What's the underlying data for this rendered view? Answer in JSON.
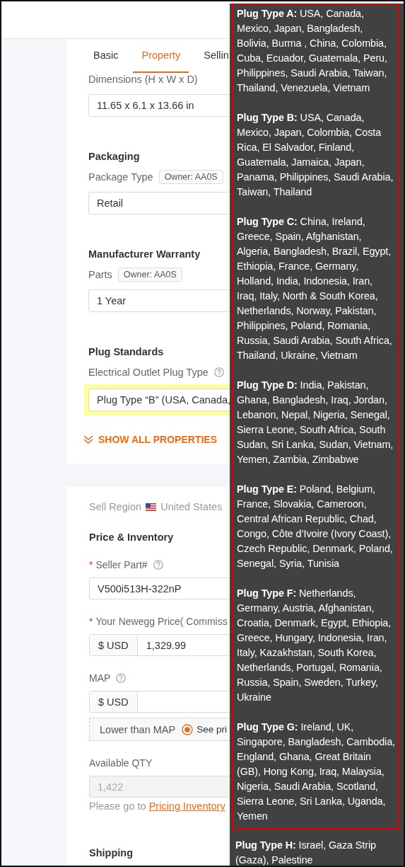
{
  "tabs": [
    {
      "label": "Basic",
      "selected": false
    },
    {
      "label": "Property",
      "selected": true
    },
    {
      "label": "Sellin",
      "selected": false
    }
  ],
  "property_card": {
    "fields": [
      {
        "label": "Dimensions (H x W x D)",
        "value": "11.65 x 6.1 x 13.66 in"
      },
      {
        "heading": "Packaging",
        "label": "Package Type",
        "owner": "Owner: AA0S",
        "value": "Retail"
      },
      {
        "heading": "Manufacturer Warranty",
        "label": "Parts",
        "owner": "Owner: AA0S",
        "value": "1 Year"
      },
      {
        "heading": "Plug Standards",
        "label": "Electrical Outlet Plug Type",
        "help": true,
        "highlighted": true,
        "value": "Plug Type “B” (USA, Canada,"
      }
    ],
    "show_all": "SHOW ALL PROPERTIES"
  },
  "selling_card": {
    "sell_region": {
      "label": "Sell Region",
      "country": "United States"
    },
    "heading": "Price & Inventory",
    "fields": [
      {
        "kind": "text",
        "marker": "*",
        "label": "Seller Part#",
        "help": true,
        "value": "V500i513H-322nP"
      },
      {
        "kind": "currency",
        "marker": "*",
        "label": "Your Newegg Price( Commiss",
        "prefix": "$ USD",
        "value": "1,329.99"
      },
      {
        "kind": "currency",
        "label": "MAP",
        "help": true,
        "prefix": "$ USD"
      },
      {
        "kind": "option",
        "label": "Lower than MAP",
        "options": [
          {
            "label": "See pri",
            "selected": true
          }
        ]
      },
      {
        "kind": "text",
        "label": "Available QTY",
        "disabled": true,
        "value": "1,422"
      },
      {
        "kind": "note",
        "text": "Please go to",
        "link": "Pricing Inventory"
      }
    ],
    "next_heading": "Shipping"
  },
  "tooltip": {
    "entries": [
      {
        "text": "**Plug Type A:** USA, Canada, Mexico, Japan, Bangladesh, Bolivia, Burma , China, Colombia, Cuba, Ecuador, Guatemala, Peru, Philippines, Saudi Arabia, Taiwan, Thailand, Venezuela, Vietnam",
        "highlighted": true
      },
      {
        "text": "**Plug Type B:** USA, Canada, Mexico, Japan, Colombia, Costa Rica, El Salvador, Finland, Guatemala, Jamaica, Japan, Panama, Philippines, Saudi Arabia, Taiwan, Thailand",
        "highlighted": true
      },
      {
        "text": "**Plug Type C:** China, Ireland, Greece, Spain, Afghanistan, Algeria, Bangladesh, Brazil, Egypt, Ethiopia, France, Germany, Holland, India, Indonesia, Iran, Iraq, Italy, North & South Korea, Netherlands, Norway, Pakistan, Philippines, Poland, Romania, Russia, Saudi Arabia, South Africa, Thailand, Ukraine, Vietnam",
        "highlighted": true
      },
      {
        "text": "**Plug Type D:** India, Pakistan, Ghana, Bangladesh, Iraq, Jordan, Lebanon, Nepal, Nigeria, Senegal, Sierra Leone, South Africa, South Sudan, Sri Lanka, Sudan, Vietnam, Yemen, Zambia, Zimbabwe",
        "highlighted": true
      },
      {
        "text": "**Plug Type E:** Poland, Belgium, France, Slovakia, Cameroon, Central African Republic, Chad, Congo, Côte d’Ivoire (Ivory Coast), Czech Republic, Denmark, Poland, Senegal, Syria, Tunisia",
        "highlighted": true
      },
      {
        "text": "**Plug Type F:** Netherlands, Germany, Austria, Afghanistan, Croatia, Denmark, Egypt, Ethiopia, Greece, Hungary, Indonesia, Iran, Italy, Kazakhstan, South Korea, Netherlands, Portugal, Romania, Russia, Spain, Sweden, Turkey, Ukraine",
        "highlighted": true
      },
      {
        "text": "**Plug Type G:** Ireland, UK, Singapore, Bangladesh, Cambodia, England, Ghana, Great Britain (GB), Hong Kong, Iraq, Malaysia, Nigeria, Saudi Arabia, Scotland, Sierra Leone, Sri Lanka, Uganda, Yemen",
        "highlighted": true
      },
      {
        "text": "**Plug Type H:** Israel, Gaza Strip (Gaza), Palestine",
        "highlighted": false
      }
    ]
  }
}
